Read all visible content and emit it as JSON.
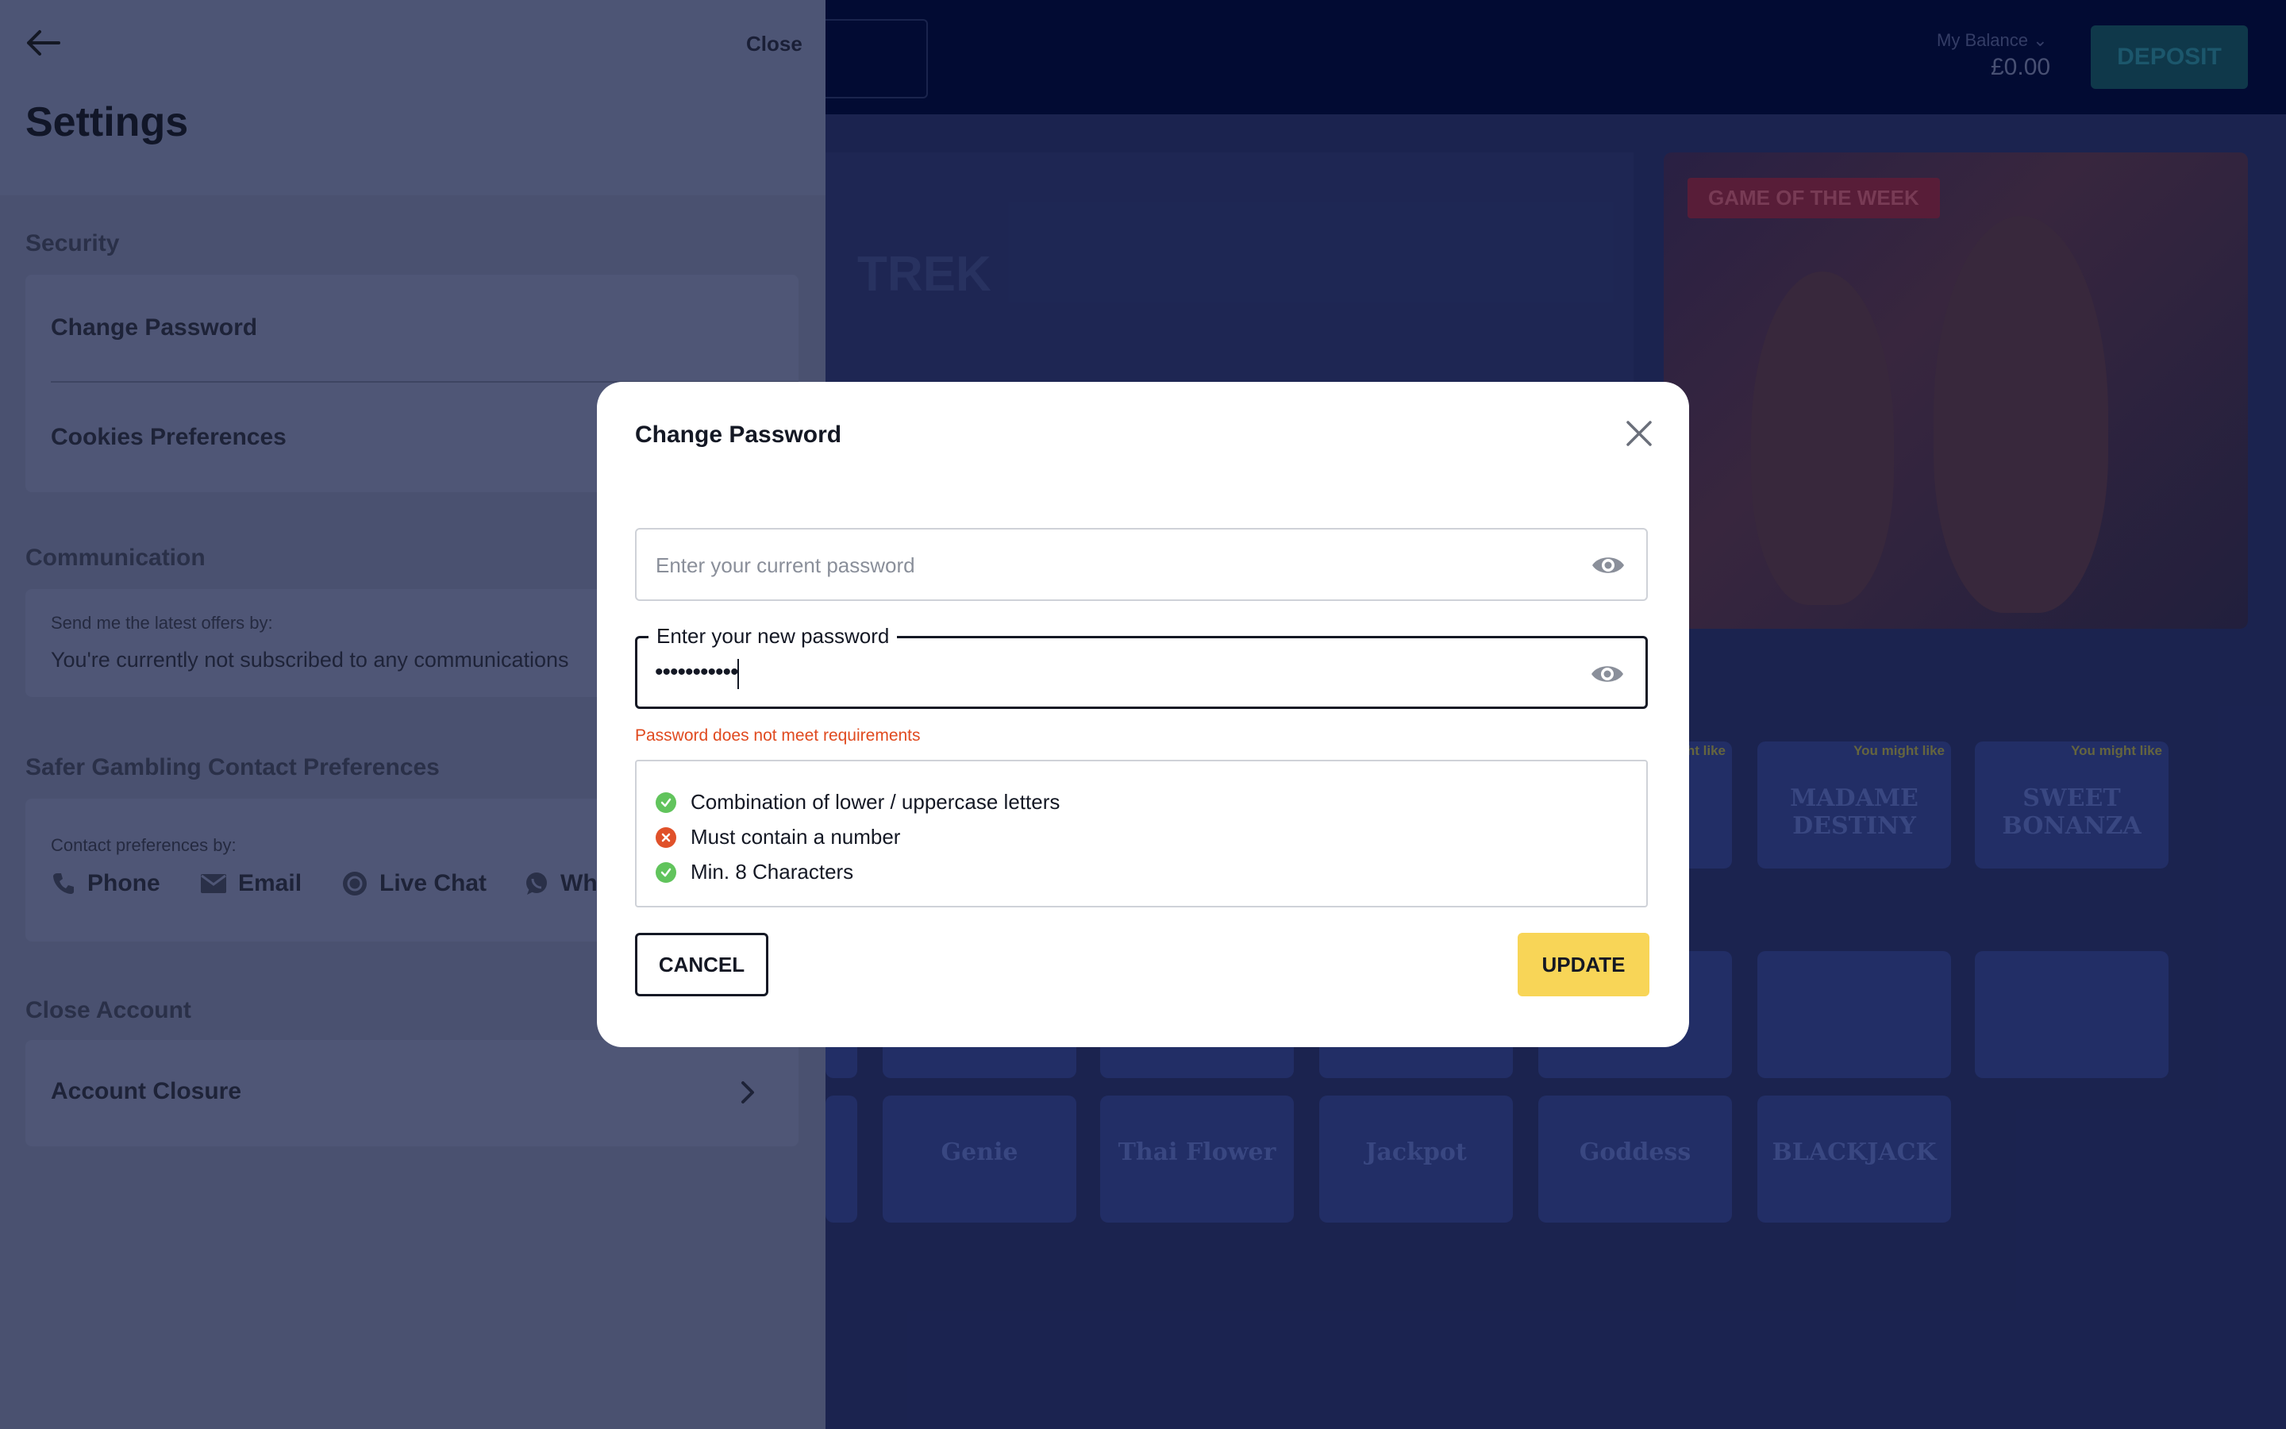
{
  "site": {
    "balance_label": "My Balance",
    "balance_value": "£0.00",
    "deposit_label": "DEPOSIT",
    "featured_tag": "GAME OF THE WEEK",
    "hero_text": "TREK",
    "tile_tag": "You might like",
    "tiles_row1": [
      "MADAME DESTINY",
      "SWEET BONANZA"
    ],
    "tiles_row3": [
      "Genie",
      "Thai Flower",
      "Jackpot",
      "Goddess",
      "BLACKJACK"
    ]
  },
  "settings": {
    "close_label": "Close",
    "title": "Settings",
    "security": {
      "heading": "Security",
      "change_password": "Change Password",
      "cookies": "Cookies Preferences"
    },
    "communication": {
      "heading": "Communication",
      "label": "Send me the latest offers by:",
      "status": "You're currently not subscribed to any communications"
    },
    "safer_gambling": {
      "heading": "Safer Gambling Contact Preferences",
      "label": "Contact preferences by:",
      "phone": "Phone",
      "email": "Email",
      "live_chat": "Live Chat",
      "whatsapp": "Wh"
    },
    "close_account": {
      "heading": "Close Account",
      "item": "Account Closure"
    }
  },
  "modal": {
    "title": "Change Password",
    "current_placeholder": "Enter your current password",
    "new_label": "Enter your new password",
    "new_value": "•••••••••••",
    "error": "Password does not meet requirements",
    "requirements": [
      {
        "text": "Combination of lower / uppercase letters",
        "met": true
      },
      {
        "text": "Must contain a number",
        "met": false
      },
      {
        "text": "Min. 8 Characters",
        "met": true
      }
    ],
    "cancel_label": "CANCEL",
    "update_label": "UPDATE"
  },
  "colors": {
    "accent_yellow": "#f8d557",
    "error_red": "#e04a1f",
    "success_green": "#61c45c"
  }
}
